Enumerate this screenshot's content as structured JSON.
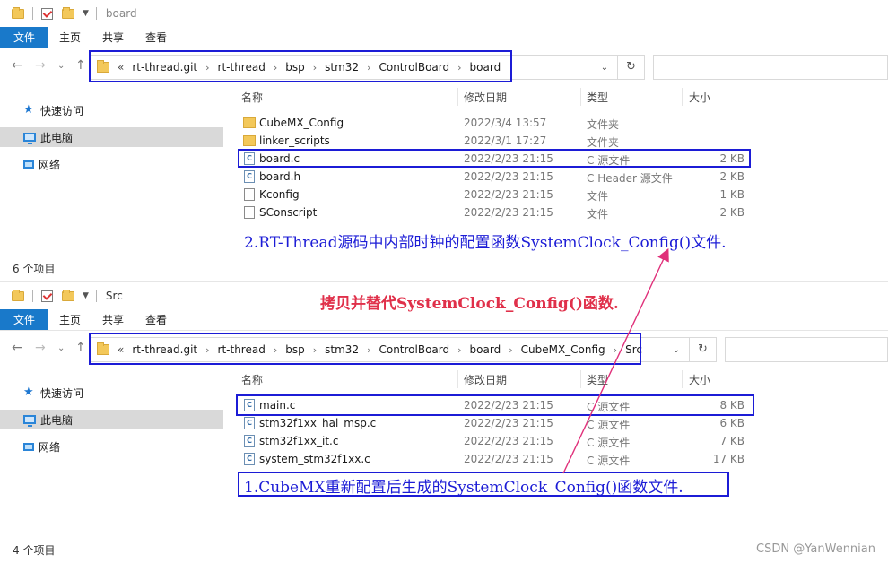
{
  "colors": {
    "accent": "#1979ca",
    "highlight_box": "#1c1cd6",
    "note_blue": "#1c1cd6",
    "note_red": "#e0304a",
    "arrow": "#e0307a"
  },
  "windows": [
    {
      "title": "board",
      "ribbon_tabs": [
        "文件",
        "主页",
        "共享",
        "查看"
      ],
      "path_lead": "«",
      "path": [
        "rt-thread.git",
        "rt-thread",
        "bsp",
        "stm32",
        "ControlBoard",
        "board"
      ],
      "sidebar": [
        "快速访问",
        "此电脑",
        "网络"
      ],
      "columns": {
        "name": "名称",
        "date": "修改日期",
        "type": "类型",
        "size": "大小"
      },
      "files": [
        {
          "name": "CubeMX_Config",
          "date": "2022/3/4 13:57",
          "type": "文件夹",
          "size": "",
          "icon": "folder-icon"
        },
        {
          "name": "linker_scripts",
          "date": "2022/3/1 17:27",
          "type": "文件夹",
          "size": "",
          "icon": "folder-icon"
        },
        {
          "name": "board.c",
          "date": "2022/2/23 21:15",
          "type": "C 源文件",
          "size": "2 KB",
          "icon": "c-file-icon"
        },
        {
          "name": "board.h",
          "date": "2022/2/23 21:15",
          "type": "C Header 源文件",
          "size": "2 KB",
          "icon": "c-file-icon"
        },
        {
          "name": "Kconfig",
          "date": "2022/2/23 21:15",
          "type": "文件",
          "size": "1 KB",
          "icon": "file-icon"
        },
        {
          "name": "SConscript",
          "date": "2022/2/23 21:15",
          "type": "文件",
          "size": "2 KB",
          "icon": "file-icon"
        }
      ],
      "status": "6 个项目"
    },
    {
      "title": "Src",
      "ribbon_tabs": [
        "文件",
        "主页",
        "共享",
        "查看"
      ],
      "path_lead": "«",
      "path": [
        "rt-thread.git",
        "rt-thread",
        "bsp",
        "stm32",
        "ControlBoard",
        "board",
        "CubeMX_Config",
        "Src"
      ],
      "sidebar": [
        "快速访问",
        "此电脑",
        "网络"
      ],
      "columns": {
        "name": "名称",
        "date": "修改日期",
        "type": "类型",
        "size": "大小"
      },
      "files": [
        {
          "name": "main.c",
          "date": "2022/2/23 21:15",
          "type": "C 源文件",
          "size": "8 KB",
          "icon": "c-file-icon"
        },
        {
          "name": "stm32f1xx_hal_msp.c",
          "date": "2022/2/23 21:15",
          "type": "C 源文件",
          "size": "6 KB",
          "icon": "c-file-icon"
        },
        {
          "name": "stm32f1xx_it.c",
          "date": "2022/2/23 21:15",
          "type": "C 源文件",
          "size": "7 KB",
          "icon": "c-file-icon"
        },
        {
          "name": "system_stm32f1xx.c",
          "date": "2022/2/23 21:15",
          "type": "C 源文件",
          "size": "17 KB",
          "icon": "c-file-icon"
        }
      ],
      "status": "4 个项目"
    }
  ],
  "annotations": {
    "note2": "2.RT-Thread源码中内部时钟的配置函数SystemClock_Config()文件.",
    "note_copy": "拷贝并替代SystemClock_Config()函数.",
    "note1": "1.CubeMX重新配置后生成的SystemClock_Config()函数文件."
  },
  "watermark": "CSDN @YanWennian"
}
